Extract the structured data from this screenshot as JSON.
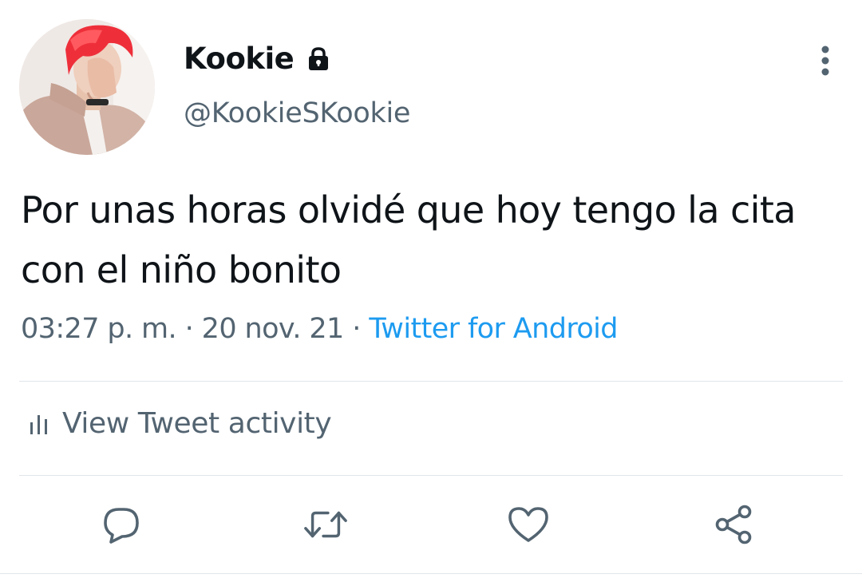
{
  "author": {
    "display_name": "Kookie",
    "handle": "@KookieSKookie",
    "avatar_icon": "profile-photo",
    "protected_icon": "lock-icon"
  },
  "tweet": {
    "text": "Por unas horas olvidé que hoy tengo la cita con el niño bonito",
    "time": "03:27 p. m.",
    "separator": "·",
    "date": "20 nov. 21",
    "source": "Twitter for Android"
  },
  "activity": {
    "label": "View Tweet activity",
    "icon": "bar-chart-icon"
  },
  "actions": {
    "reply_icon": "reply-icon",
    "retweet_icon": "retweet-icon",
    "like_icon": "heart-icon",
    "share_icon": "share-icon",
    "more_icon": "more-vertical-icon"
  },
  "colors": {
    "text_primary": "#0f1419",
    "text_secondary": "#536471",
    "link": "#1d9bf0",
    "divider": "#e1e6ea",
    "icon": "#536471"
  }
}
